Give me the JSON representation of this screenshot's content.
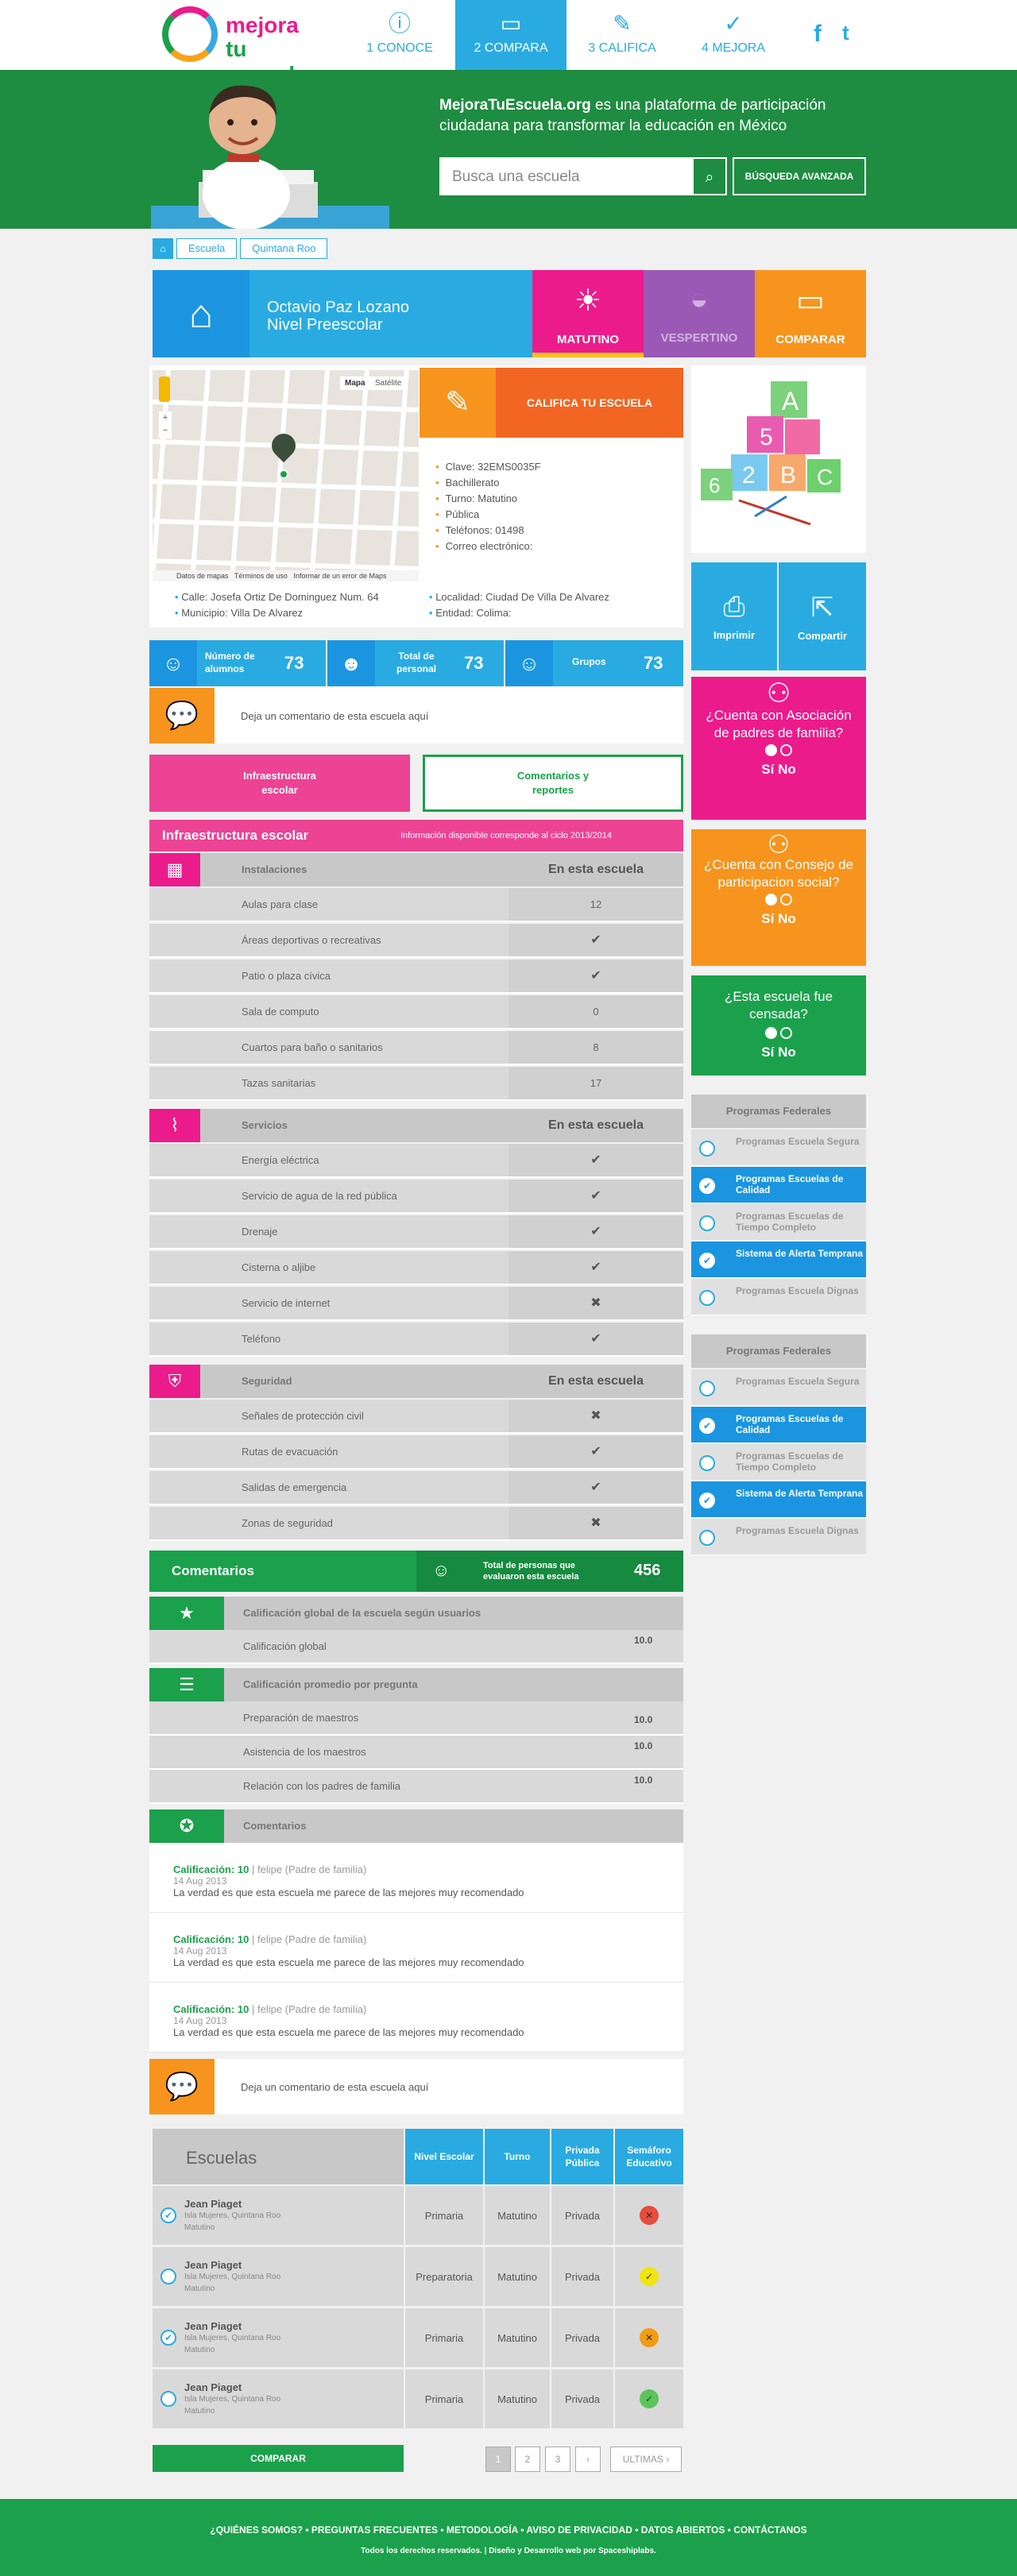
{
  "header": {
    "logo_line1": "mejora",
    "logo_line2": "tu escuela",
    "nav": [
      {
        "num": "1",
        "label": "CONOCE",
        "icon": "info-icon"
      },
      {
        "num": "2",
        "label": "COMPARA",
        "icon": "ruler-icon"
      },
      {
        "num": "3",
        "label": "CALIFICA",
        "icon": "pencil-icon"
      },
      {
        "num": "4",
        "label": "MEJORA",
        "icon": "check-icon"
      }
    ],
    "facebook": "f",
    "twitter": "t"
  },
  "hero": {
    "brand": "MejoraTuEscuela.org",
    "tagline": " es una plataforma de participación ciudadana para transformar la educación en México",
    "search_placeholder": "Busca una escuela",
    "advanced": "BÚSQUEDA AVANZADA"
  },
  "breadcrumb": [
    "Escuela",
    "Quintana Roo"
  ],
  "school": {
    "name": "Octavio Paz Lozano",
    "level": "Nivel Preescolar",
    "tabs": [
      {
        "label": "MATUTINO",
        "color": "#ec1b8c"
      },
      {
        "label": "VESPERTINO",
        "color": "#9b59b6"
      },
      {
        "label": "COMPARAR",
        "color": "#f7941d"
      }
    ]
  },
  "map": {
    "map_btn": "Mapa",
    "sat_btn": "Satélite",
    "footer": [
      "Datos de mapas",
      "Términos de uso",
      "Informar de un error de Maps"
    ]
  },
  "califica_label": "CALIFICA TU ESCUELA",
  "info": [
    "Clave: 32EMS0035F",
    "Bachillerato",
    "Turno: Matutino",
    "Pública",
    "Teléfonos: 01498",
    "Correo electrónico:"
  ],
  "address": {
    "calle": "Calle: Josefa Ortiz De Dominguez Num. 64",
    "municipio": "Municipio: Villa De Alvarez",
    "localidad": "Localidad: Ciudad De Villa De Alvarez",
    "entidad": "Entidad: Colima:"
  },
  "stats": [
    {
      "label": "Número de alumnos",
      "value": "73"
    },
    {
      "label": "Total de personal",
      "value": "73"
    },
    {
      "label": "Grupos",
      "value": "73"
    }
  ],
  "comment_prompt": "Deja un comentario de esta escuela aquí",
  "tab_infra": "Infraestructura escolar",
  "tab_comentarios": "Comentarios y reportes",
  "infra": {
    "title": "Infraestructura escolar",
    "note": "Información disponible corresponde al ciclo 2013/2014",
    "col_header": "En esta escuela",
    "groups": [
      {
        "name": "Instalaciones",
        "rows": [
          {
            "label": "Aulas para clase",
            "value": "12"
          },
          {
            "label": "Áreas deportivas o recreativas",
            "value": "✔"
          },
          {
            "label": "Patio o plaza cívica",
            "value": "✔"
          },
          {
            "label": "Sala de computo",
            "value": "0"
          },
          {
            "label": "Cuartos para baño o sanitarios",
            "value": "8"
          },
          {
            "label": "Tazas sanitarias",
            "value": "17"
          }
        ]
      },
      {
        "name": "Servicios",
        "rows": [
          {
            "label": "Energía eléctrica",
            "value": "✔"
          },
          {
            "label": "Servicio de agua de la red pública",
            "value": "✔"
          },
          {
            "label": "Drenaje",
            "value": "✔"
          },
          {
            "label": "Cisterna o aljibe",
            "value": "✔"
          },
          {
            "label": "Servicio de internet",
            "value": "✖"
          },
          {
            "label": "Teléfono",
            "value": "✔"
          }
        ]
      },
      {
        "name": "Seguridad",
        "rows": [
          {
            "label": "Señales de protección civil",
            "value": "✖"
          },
          {
            "label": "Rutas de evacuación",
            "value": "✔"
          },
          {
            "label": "Salidas de emergencia",
            "value": "✔"
          },
          {
            "label": "Zonas de seguridad",
            "value": "✖"
          }
        ]
      }
    ]
  },
  "comentarios": {
    "title": "Comentarios",
    "total_label": "Total de personas que evaluaron esta escuela",
    "total": "456",
    "global_hdr": "Calificación global de la escuela según usuarios",
    "global_label": "Calificación global",
    "global_value": "10.0",
    "promedio_hdr": "Calificación promedio por pregunta",
    "promedio": [
      {
        "label": "Preparación de maestros",
        "value": "10.0"
      },
      {
        "label": "Asistencia de los maestros",
        "value": "10.0"
      },
      {
        "label": "Relación con los padres de familia",
        "value": "10.0"
      }
    ],
    "list_hdr": "Comentarios",
    "items": [
      {
        "score": "Calificación: 10",
        "author": "felipe (Padre de familia)",
        "date": "14 Aug 2013",
        "text": "La verdad es que esta escuela me parece de las mejores muy recomendado"
      },
      {
        "score": "Calificación: 10",
        "author": "felipe (Padre de familia)",
        "date": "14 Aug 2013",
        "text": "La verdad es que esta escuela me parece de las mejores muy recomendado"
      },
      {
        "score": "Calificación: 10",
        "author": "felipe (Padre de familia)",
        "date": "14 Aug 2013",
        "text": "La verdad es que esta escuela me parece de las mejores muy recomendado"
      }
    ]
  },
  "escuelas": {
    "title": "Escuelas",
    "headers": [
      "Nivel Escolar",
      "Turno",
      "Privada Pública",
      "Semáforo Educativo"
    ],
    "rows": [
      {
        "name": "Jean Piaget",
        "loc": "Isla Mujeres, Quintana Roo",
        "turno": "Matutino",
        "nivel": "Primaria",
        "t": "Matutino",
        "tipo": "Privada",
        "sem": "#e74c3c",
        "checked": true
      },
      {
        "name": "Jean Piaget",
        "loc": "Isla Mujeres, Quintana Roo",
        "turno": "Matutino",
        "nivel": "Preparatoria",
        "t": "Matutino",
        "tipo": "Privada",
        "sem": "#f1e40f",
        "checked": false
      },
      {
        "name": "Jean Piaget",
        "loc": "Isla Mujeres, Quintana Roo",
        "turno": "Matutino",
        "nivel": "Primaria",
        "t": "Matutino",
        "tipo": "Privada",
        "sem": "#f39c12",
        "checked": true
      },
      {
        "name": "Jean Piaget",
        "loc": "Isla Mujeres, Quintana Roo",
        "turno": "Matutino",
        "nivel": "Primaria",
        "t": "Matutino",
        "tipo": "Privada",
        "sem": "#5bc45b",
        "checked": false
      }
    ],
    "compare_btn": "COMPARAR",
    "pages": [
      "1",
      "2",
      "3",
      "›",
      "ULTIMAS ›"
    ]
  },
  "right": {
    "imprimir": "Imprimir",
    "compartir": "Compartir",
    "q1": "¿Cuenta con Asociación de padres de familia?",
    "q2": "¿Cuenta con Consejo de participacion social?",
    "q3": "¿Esta escuela fue censada?",
    "si": "Sí",
    "no": "No",
    "programs_title": "Programas Federales",
    "programs": [
      {
        "label": "Programas Escuela Segura",
        "on": false
      },
      {
        "label": "Programas Escuelas de Calidad",
        "on": true
      },
      {
        "label": "Programas Escuelas de Tiempo Completo",
        "on": false
      },
      {
        "label": "Sistema de Alerta Temprana",
        "on": true
      },
      {
        "label": "Programas Escuela Dignas",
        "on": false
      }
    ]
  },
  "footer": {
    "links": "¿QUIÉNES SOMOS?  •  PREGUNTAS FRECUENTES  •  METODOLOGÍA  •  AVISO DE PRIVACIDAD  •  DATOS ABIERTOS  •  CONTÁCTANOS",
    "copy": "Todos los derechos reservados. | Diseño y Desarrollo web por Spaceshiplabs."
  }
}
